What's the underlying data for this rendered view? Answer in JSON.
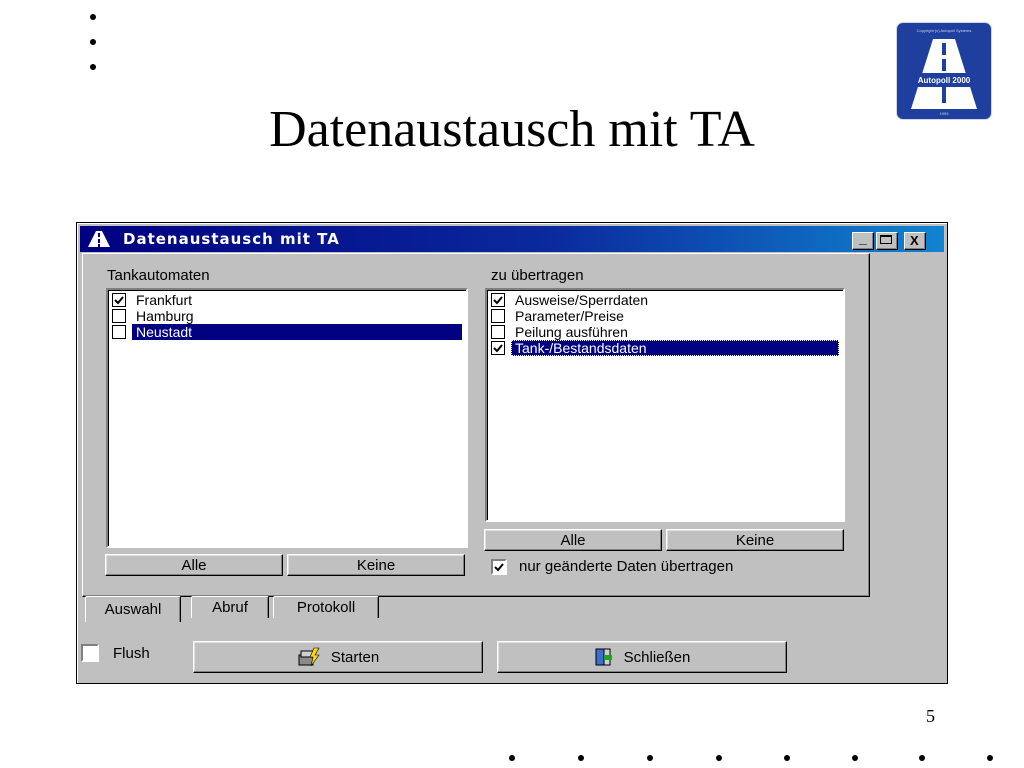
{
  "slide": {
    "title": "Datenaustausch mit TA",
    "page_number": "5"
  },
  "logo": {
    "brand": "Autopoll 2000",
    "tiny_top": "Copyright (c) Autopoll Systems",
    "tiny_bottom": "1999"
  },
  "dialog": {
    "title": "Datenaustausch mit TA",
    "window_buttons": {
      "minimize": "_",
      "maximize": "□",
      "close": "X"
    },
    "left_group": {
      "label": "Tankautomaten",
      "items": [
        {
          "label": "Frankfurt",
          "checked": true,
          "selected": false
        },
        {
          "label": "Hamburg",
          "checked": false,
          "selected": false
        },
        {
          "label": "Neustadt",
          "checked": false,
          "selected": true
        }
      ],
      "all_label": "Alle",
      "none_label": "Keine"
    },
    "right_group": {
      "label": "zu übertragen",
      "items": [
        {
          "label": "Ausweise/Sperrdaten",
          "checked": true,
          "selected": false
        },
        {
          "label": "Parameter/Preise",
          "checked": false,
          "selected": false
        },
        {
          "label": "Peilung ausführen",
          "checked": false,
          "selected": false
        },
        {
          "label": "Tank-/Bestandsdaten",
          "checked": true,
          "selected": true
        }
      ],
      "all_label": "Alle",
      "none_label": "Keine",
      "only_changed_label": "nur geänderte Daten übertragen",
      "only_changed_checked": true
    },
    "tabs": [
      {
        "label": "Auswahl",
        "active": true
      },
      {
        "label": "Abruf",
        "active": false
      },
      {
        "label": "Protokoll",
        "active": false
      }
    ],
    "flush_label": "Flush",
    "flush_checked": false,
    "start_label": "Starten",
    "close_label": "Schließen"
  },
  "colors": {
    "window_face": "#c0c0c0",
    "titlebar": "#000080",
    "selection": "#000080",
    "logo_blue": "#1f3f9f"
  }
}
